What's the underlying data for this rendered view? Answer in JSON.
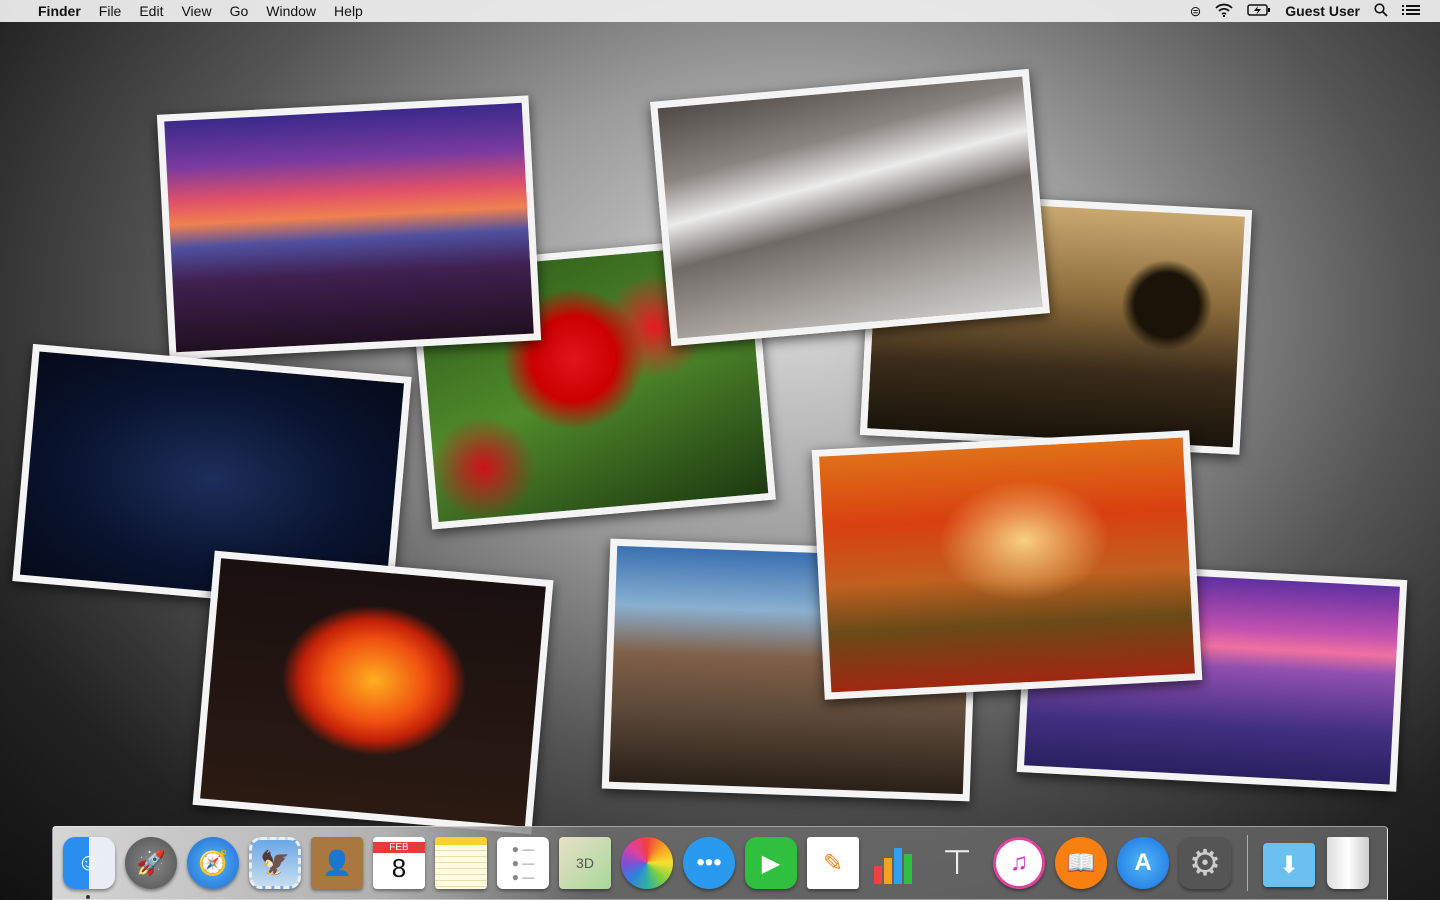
{
  "menubar": {
    "app": "Finder",
    "items": [
      "File",
      "Edit",
      "View",
      "Go",
      "Window",
      "Help"
    ],
    "user": "Guest User",
    "status_icons": [
      "creative-cloud-icon",
      "wifi-icon",
      "battery-charging-icon",
      "search-icon",
      "notification-center-icon"
    ]
  },
  "desktop": {
    "photos": [
      "sunset-beach",
      "red-tulips",
      "leaping-fish-wave",
      "swimmer-silhouette",
      "candle-smoke",
      "orange-tulip",
      "horse-lying",
      "autumn-forest",
      "boat-lake-sunset"
    ]
  },
  "dock": {
    "apps": [
      "Finder",
      "Launchpad",
      "Safari",
      "Mail",
      "Contacts",
      "Calendar",
      "Notes",
      "Reminders",
      "Maps",
      "Photos",
      "Messages",
      "FaceTime",
      "Pages",
      "Numbers",
      "Keynote",
      "iTunes",
      "iBooks",
      "App Store",
      "System Preferences",
      "Downloads",
      "Trash"
    ],
    "calendar_month": "FEB",
    "calendar_day": "8"
  }
}
